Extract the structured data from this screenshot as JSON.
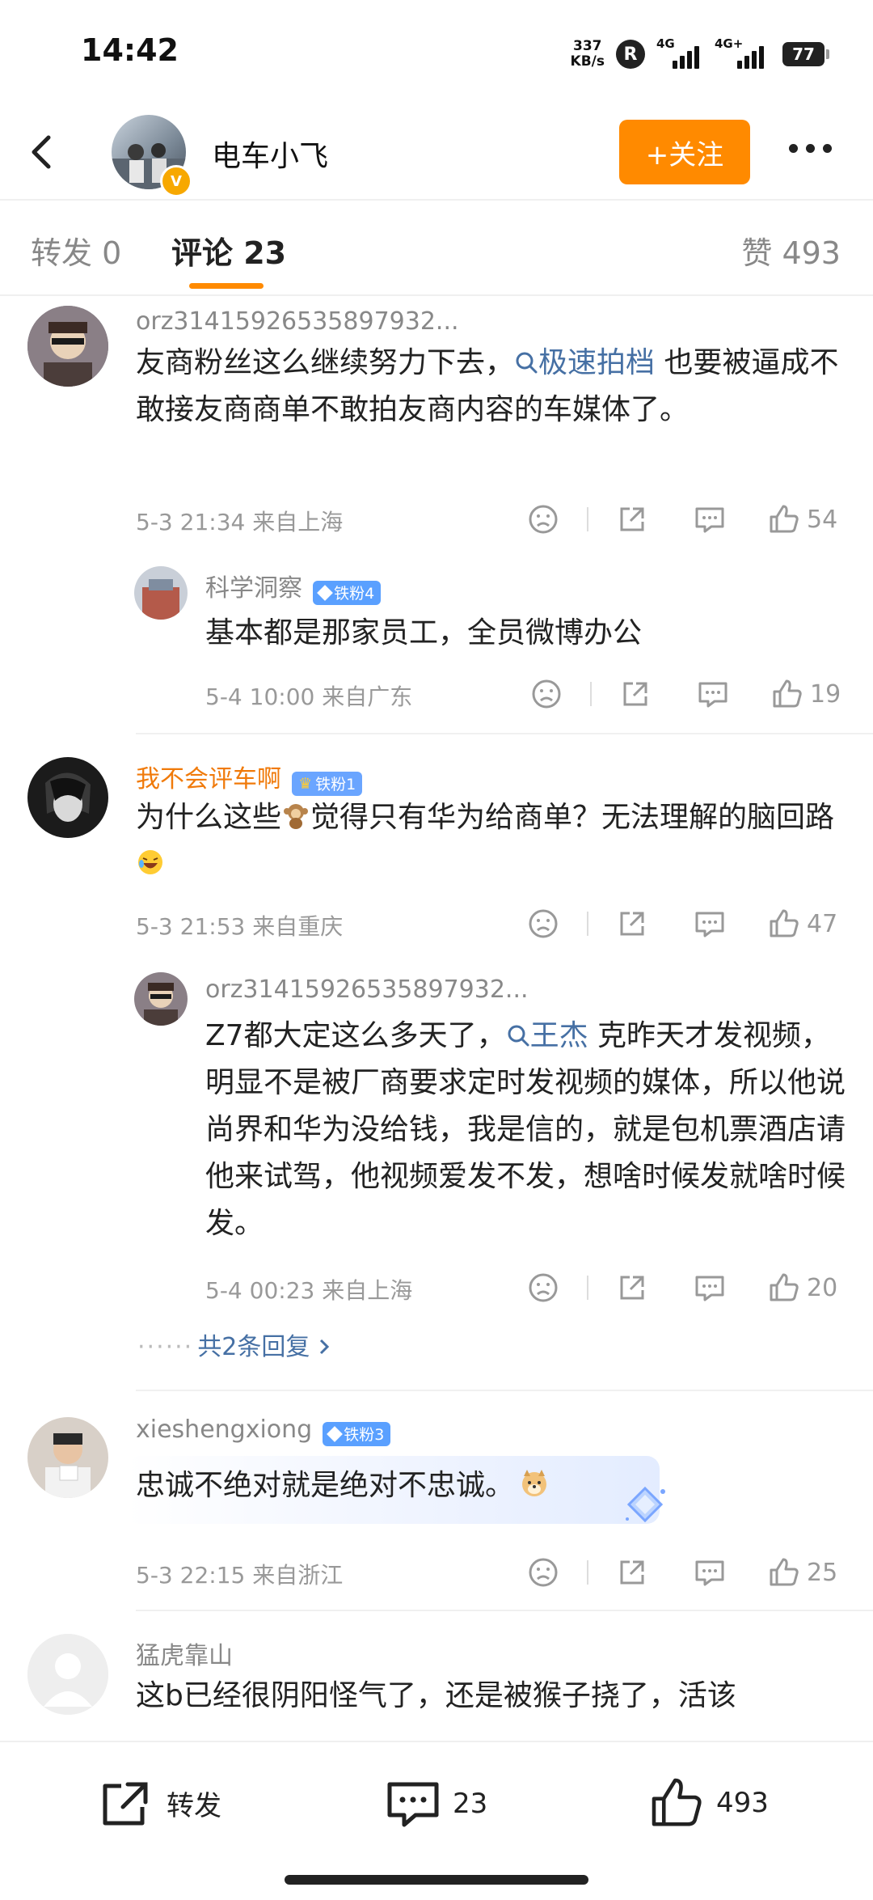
{
  "status_bar": {
    "time": "14:42",
    "net_speed_value": "337",
    "net_speed_unit": "KB/s",
    "r_badge": "R",
    "signal1": "4G",
    "signal2": "4G+",
    "battery": "77"
  },
  "header": {
    "title": "电车小飞",
    "follow_label": "+关注",
    "avatar_icon": "user-avatar-icon",
    "verified_icon": "v-badge"
  },
  "tabs": {
    "repost": "转发 0",
    "comments": "评论 23",
    "likes": "赞 493"
  },
  "comments": [
    {
      "name": "orz31415926535897932...",
      "text_before": "友商粉丝这么继续努力下去，",
      "link": "极速拍档",
      "text_after": " 也要被逼成不敢接友商商单不敢拍友商内容的车媒体了。",
      "meta": "5-3 21:34  来自上海",
      "likes": "54"
    },
    {
      "name": "科学洞察",
      "badge": "铁粉4",
      "text": "基本都是那家员工，全员微博办公",
      "meta": "5-4 10:00  来自广东",
      "likes": "19"
    },
    {
      "name": "我不会评车啊",
      "badge": "铁粉1",
      "text_before": "为什么这些",
      "text_mid": "觉得只有华为给商单？无法理解的脑回路",
      "meta": "5-3 21:53  来自重庆",
      "likes": "47"
    },
    {
      "name": "orz31415926535897932...",
      "text_before": "Z7都大定这么多天了，",
      "link": "王杰",
      "text_after": " 克昨天才发视频，明显不是被厂商要求定时发视频的媒体，所以他说尚界和华为没给钱，我是信的，就是包机票酒店请他来试驾，他视频爱发不发，想啥时候发就啥时候发。",
      "meta": "5-4 00:23  来自上海",
      "likes": "20",
      "more_replies": "共2条回复"
    },
    {
      "name": "xieshengxiong",
      "badge": "铁粉3",
      "text": "忠诚不绝对就是绝对不忠诚。",
      "meta": "5-3 22:15  来自浙江",
      "likes": "25"
    },
    {
      "name": "猛虎靠山",
      "text": "这b已经很阴阳怪气了，还是被猴子挠了，活该"
    }
  ],
  "bottom_bar": {
    "repost_label": "转发",
    "comment_count": "23",
    "like_count": "493"
  }
}
